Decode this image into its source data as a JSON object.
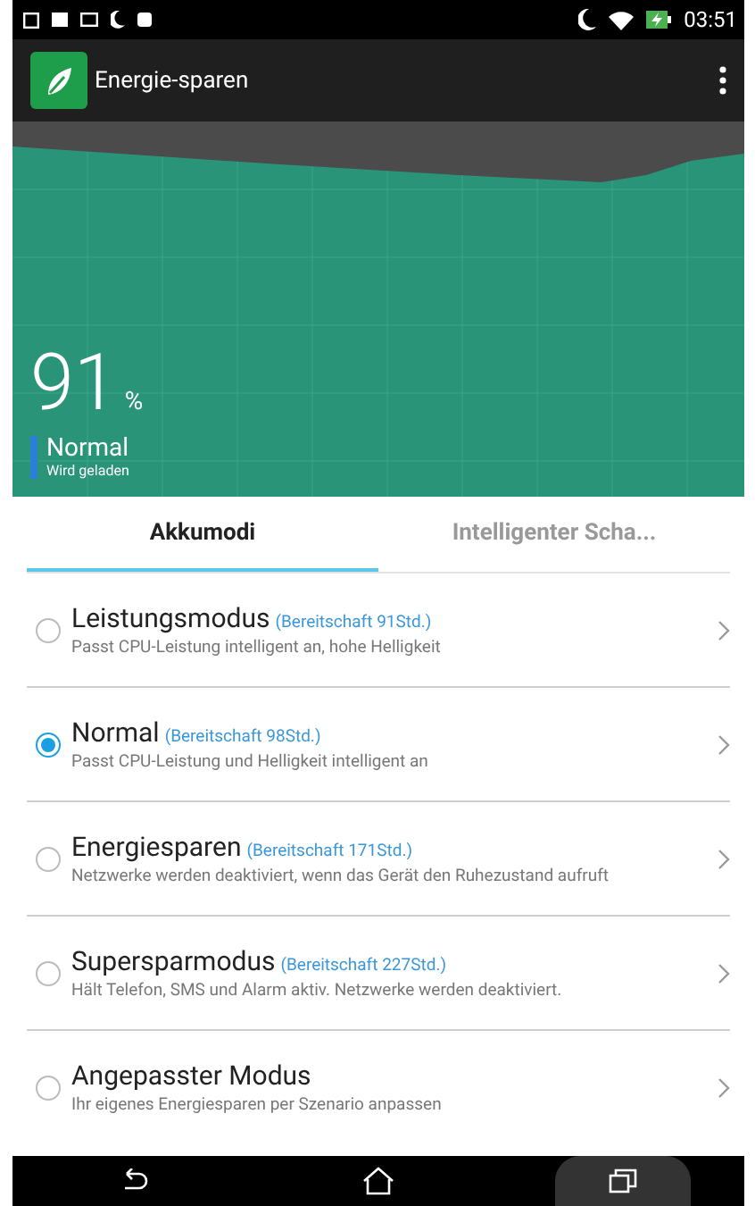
{
  "status_bar": {
    "time": "03:51"
  },
  "app_bar": {
    "title": "Energie-sparen"
  },
  "battery": {
    "percent": "91",
    "unit": "%",
    "mode": "Normal",
    "state": "Wird geladen"
  },
  "tabs": [
    {
      "label": "Akkumodi",
      "selected": true
    },
    {
      "label": "Intelligenter Scha...",
      "selected": false
    }
  ],
  "modes": [
    {
      "name": "Leistungsmodus",
      "standby": "(Bereitschaft 91Std.)",
      "description": "Passt CPU-Leistung intelligent an, hohe Helligkeit",
      "selected": false
    },
    {
      "name": "Normal",
      "standby": "(Bereitschaft 98Std.)",
      "description": "Passt CPU-Leistung und Helligkeit intelligent an",
      "selected": true
    },
    {
      "name": "Energiesparen",
      "standby": "(Bereitschaft 171Std.)",
      "description": "Netzwerke werden deaktiviert, wenn das Gerät den Ruhezustand aufruft",
      "selected": false
    },
    {
      "name": "Supersparmodus",
      "standby": "(Bereitschaft 227Std.)",
      "description": "Hält Telefon, SMS und Alarm aktiv. Netzwerke werden deaktiviert.",
      "selected": false
    },
    {
      "name": "Angepasster Modus",
      "description": "Ihr eigenes Energiesparen per Szenario anpassen",
      "selected": false
    }
  ]
}
